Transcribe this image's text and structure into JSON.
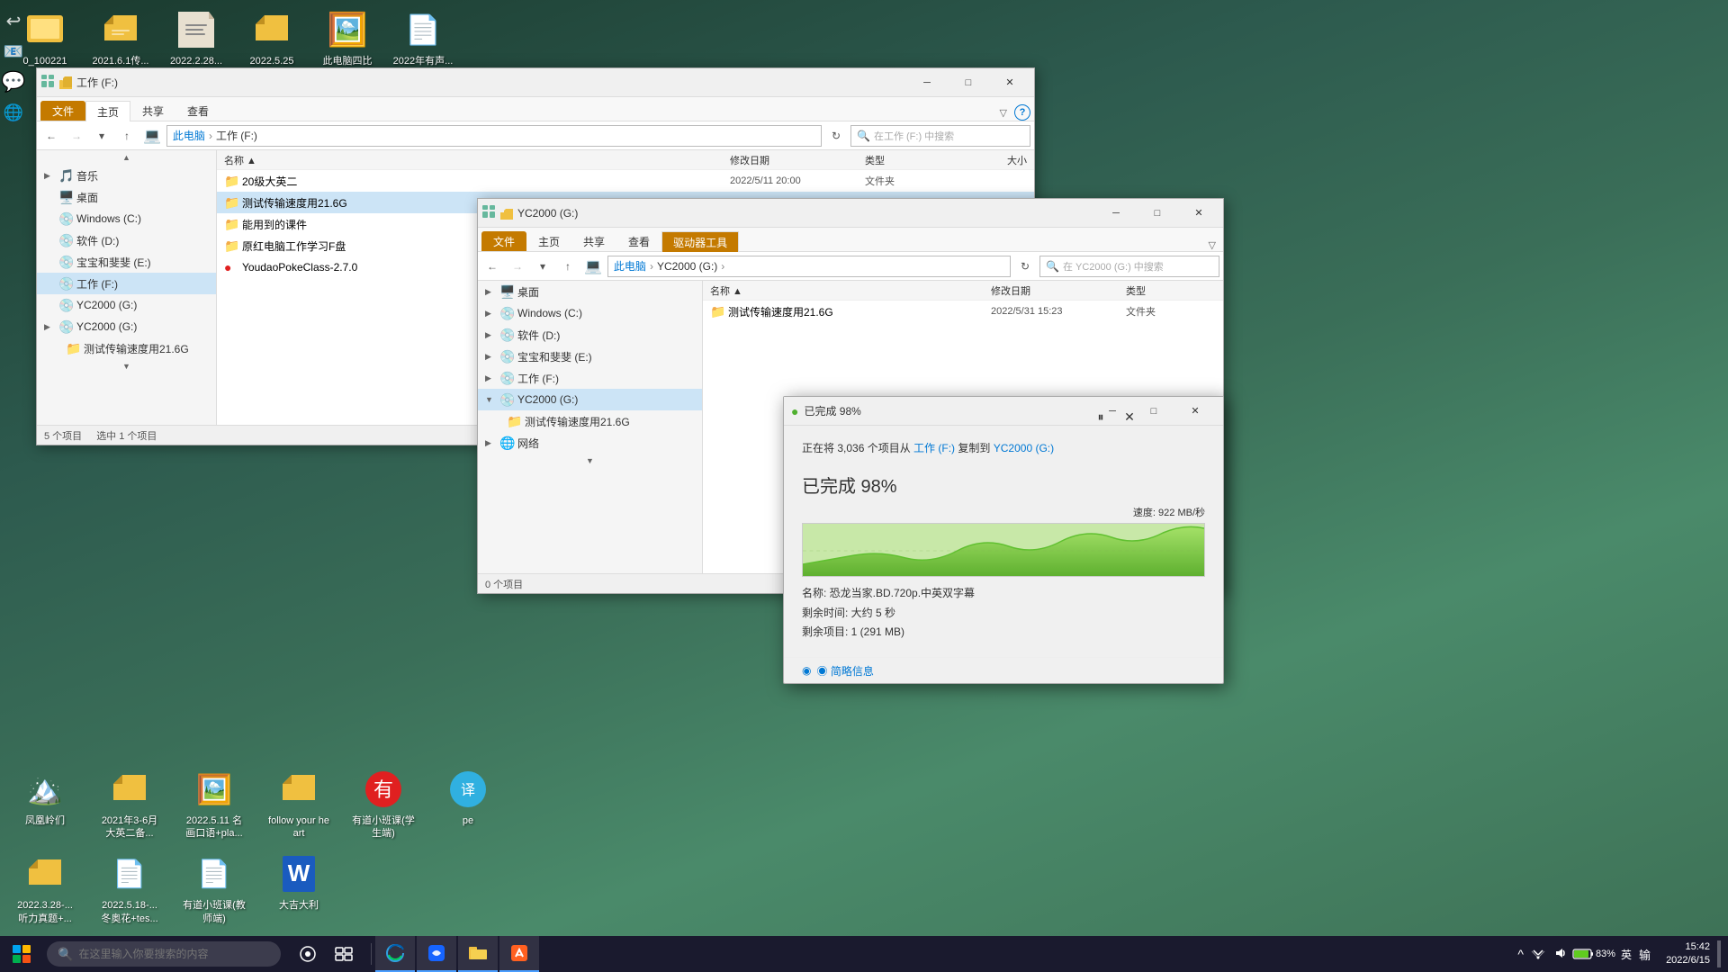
{
  "desktop": {
    "background": "linear-gradient(160deg, #1a3a2e, #2d5a4e, #4a8a6a)",
    "top_icons": [
      {
        "label": "0_100221",
        "icon": "🟡",
        "color": "#f0c040"
      },
      {
        "label": "2021.6.1传...",
        "icon": "📁",
        "color": "#f0c040"
      },
      {
        "label": "2022.2.28...",
        "icon": "📄"
      },
      {
        "label": "2022.5.25 传...",
        "icon": "📁",
        "color": "#f0c040"
      },
      {
        "label": "此电脑四比划...",
        "icon": "🖼️"
      },
      {
        "label": "2022年有声...",
        "icon": "📄"
      }
    ],
    "bottom_icons": [
      {
        "label": "凤凰岭们",
        "icon": "🏔️"
      },
      {
        "label": "2021年3-6月大英二备...",
        "icon": "📁",
        "color": "#f0c040"
      },
      {
        "label": "2022.5.11 名画口语+pla...",
        "icon": "📄"
      },
      {
        "label": "follow your heart",
        "icon": "📁",
        "color": "#f0c040"
      },
      {
        "label": "有道小班课(学生端)",
        "icon": "❤️",
        "color": "#e02020"
      },
      {
        "label": "pe",
        "icon": "🌐",
        "color": "#30b0e0"
      },
      {
        "label": "2022.3.28-... 听力真题+...",
        "icon": "📁",
        "color": "#f0c040"
      },
      {
        "label": "2022.5.18-... 冬奥花+tes...",
        "icon": "📄"
      },
      {
        "label": "有道小班课(教师端)",
        "icon": "📄"
      },
      {
        "label": "大吉大利",
        "icon": "📝",
        "color": "#2060d0"
      }
    ]
  },
  "taskbar": {
    "search_placeholder": "在这里输入你要搜索的内容",
    "time": "15:42",
    "date": "2022/6/15",
    "battery_percent": "83%",
    "lang": "英"
  },
  "main_explorer": {
    "title": "工作 (F:)",
    "tabs": [
      "文件",
      "主页",
      "共享",
      "查看"
    ],
    "active_tab": "主页",
    "breadcrumb": [
      "此电脑",
      "工作 (F:)"
    ],
    "search_placeholder": "在工作 (F:) 中搜索",
    "nav_items": [
      {
        "label": "音乐",
        "icon": "🎵",
        "indent": 0,
        "expanded": false
      },
      {
        "label": "桌面",
        "icon": "🖥️",
        "indent": 0
      },
      {
        "label": "Windows (C:)",
        "icon": "💿",
        "indent": 0
      },
      {
        "label": "软件 (D:)",
        "icon": "💿",
        "indent": 0
      },
      {
        "label": "宝宝和斐斐 (E:)",
        "icon": "💿",
        "indent": 0
      },
      {
        "label": "工作 (F:)",
        "icon": "💿",
        "indent": 0,
        "selected": true
      },
      {
        "label": "YC2000 (G:)",
        "icon": "💿",
        "indent": 0
      },
      {
        "label": "YC2000 (G:)",
        "icon": "💿",
        "indent": 0
      },
      {
        "label": "测试传输速度用21.6G",
        "icon": "📁",
        "indent": 1
      }
    ],
    "files": [
      {
        "name": "20级大英二",
        "icon": "📁",
        "date": "2022/5/11 20:00",
        "type": "文件夹"
      },
      {
        "name": "测试传输速度用21.6G",
        "icon": "📁",
        "date": "",
        "type": "",
        "selected": true
      },
      {
        "name": "能用到的课件",
        "icon": "📁",
        "date": "",
        "type": ""
      },
      {
        "name": "原红电脑工作学习F盘",
        "icon": "📁",
        "date": "",
        "type": ""
      },
      {
        "name": "YoudaoPokeClass-2.7.0",
        "icon": "🔴",
        "date": "",
        "type": ""
      }
    ],
    "status": "5 个项目",
    "status_selected": "选中 1 个项目"
  },
  "yc_explorer": {
    "title": "YC2000 (G:)",
    "tabs": [
      "文件",
      "主页",
      "共享",
      "查看",
      "驱动器工具"
    ],
    "active_tab": "管理",
    "breadcrumb": [
      "此电脑",
      "YC2000 (G:)"
    ],
    "search_placeholder": "在 YC2000 (G:) 中搜索",
    "nav_items": [
      {
        "label": "桌面",
        "icon": "🖥️",
        "indent": 0,
        "expanded": false
      },
      {
        "label": "Windows (C:)",
        "icon": "💿",
        "indent": 0,
        "expanded": false
      },
      {
        "label": "软件 (D:)",
        "icon": "💿",
        "indent": 0,
        "expanded": false
      },
      {
        "label": "宝宝和斐斐 (E:)",
        "icon": "💿",
        "indent": 0,
        "expanded": false
      },
      {
        "label": "工作 (F:)",
        "icon": "💿",
        "indent": 0,
        "expanded": false
      },
      {
        "label": "YC2000 (G:)",
        "icon": "💿",
        "indent": 0,
        "expanded": true,
        "selected": true
      },
      {
        "label": "测试传输速度用21.6G",
        "icon": "📁",
        "indent": 1
      },
      {
        "label": "网络",
        "icon": "🌐",
        "indent": 0,
        "expanded": false
      }
    ],
    "files": [
      {
        "name": "测试传输速度用21.6G",
        "icon": "📁",
        "date": "2022/5/31 15:23",
        "type": "文件夹"
      }
    ],
    "status": "0 个项目"
  },
  "progress_dialog": {
    "title": "已完成 98%",
    "header_icon": "🟢",
    "copy_text": "正在将 3,036 个项目从",
    "from_label": "工作 (F:)",
    "to_text": "复制到",
    "to_label": "YC2000 (G:)",
    "percent_label": "已完成 98%",
    "progress_value": 98,
    "speed_label": "速度: 922 MB/秒",
    "file_name_label": "名称: 恐龙当家.BD.720p.中英双字幕",
    "time_remaining_label": "剩余时间: 大约 5 秒",
    "items_remaining_label": "剩余项目: 1 (291 MB)",
    "accordion_label": "◉ 简略信息",
    "pause_title": "暂停",
    "cancel_title": "取消"
  }
}
